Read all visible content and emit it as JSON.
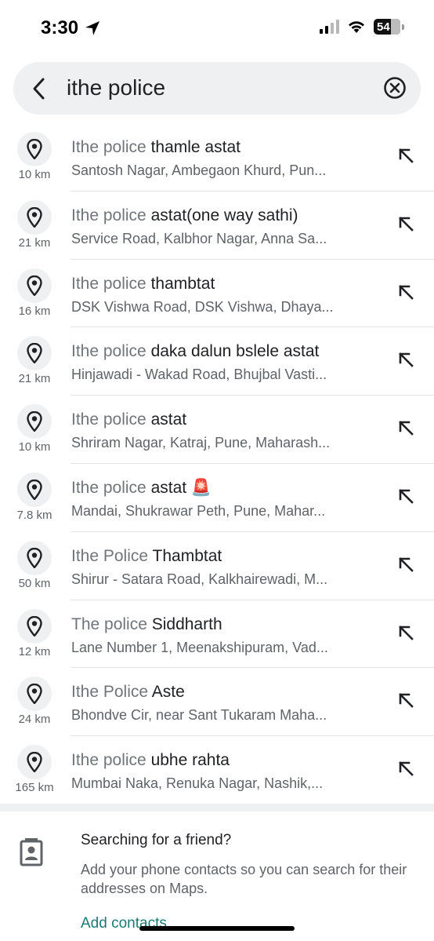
{
  "status": {
    "time": "3:30",
    "battery": "54"
  },
  "search": {
    "query": "ithe police"
  },
  "results": [
    {
      "query_part": "Ithe police",
      "rest": " thamle astat",
      "address": "Santosh Nagar, Ambegaon Khurd, Pun...",
      "distance": "10 km"
    },
    {
      "query_part": "Ithe police",
      "rest": " astat(one way sathi)",
      "address": "Service Road, Kalbhor Nagar, Anna Sa...",
      "distance": "21 km"
    },
    {
      "query_part": "Ithe police",
      "rest": " thambtat",
      "address": "DSK Vishwa Road, DSK Vishwa, Dhaya...",
      "distance": "16 km"
    },
    {
      "query_part": "Ithe police",
      "rest": " daka dalun bslele astat",
      "address": "Hinjawadi - Wakad Road, Bhujbal Vasti...",
      "distance": "21 km"
    },
    {
      "query_part": "Ithe police",
      "rest": " astat",
      "address": "Shriram Nagar, Katraj, Pune, Maharash...",
      "distance": "10 km"
    },
    {
      "query_part": "Ithe police",
      "rest": " astat 🚨",
      "address": "Mandai, Shukrawar Peth, Pune, Mahar...",
      "distance": "7.8 km"
    },
    {
      "query_part": "Ithe Police",
      "rest": " Thambtat",
      "address": "Shirur - Satara Road, Kalkhairewadi, M...",
      "distance": "50 km"
    },
    {
      "query_part": "The police",
      "rest": " Siddharth",
      "address": "Lane Number 1, Meenakshipuram, Vad...",
      "distance": "12 km"
    },
    {
      "query_part": "Ithe Police",
      "rest": " Aste",
      "address": "Bhondve Cir, near Sant Tukaram Maha...",
      "distance": "24 km"
    },
    {
      "query_part": "Ithe police",
      "rest": " ubhe rahta",
      "address": "Mumbai Naka, Renuka Nagar, Nashik,...",
      "distance": "165 km"
    }
  ],
  "friend_card": {
    "title": "Searching for a friend?",
    "description": "Add your phone contacts so you can search for their addresses on Maps.",
    "action": "Add contacts"
  },
  "icons": {
    "back": "back-arrow-icon",
    "clear": "clear-circle-x-icon",
    "pin": "location-pin-icon",
    "fill": "fill-query-arrow-icon",
    "contact": "contact-card-icon"
  },
  "colors": {
    "accent": "#1a7a73",
    "search_bg": "#eef0f1"
  }
}
